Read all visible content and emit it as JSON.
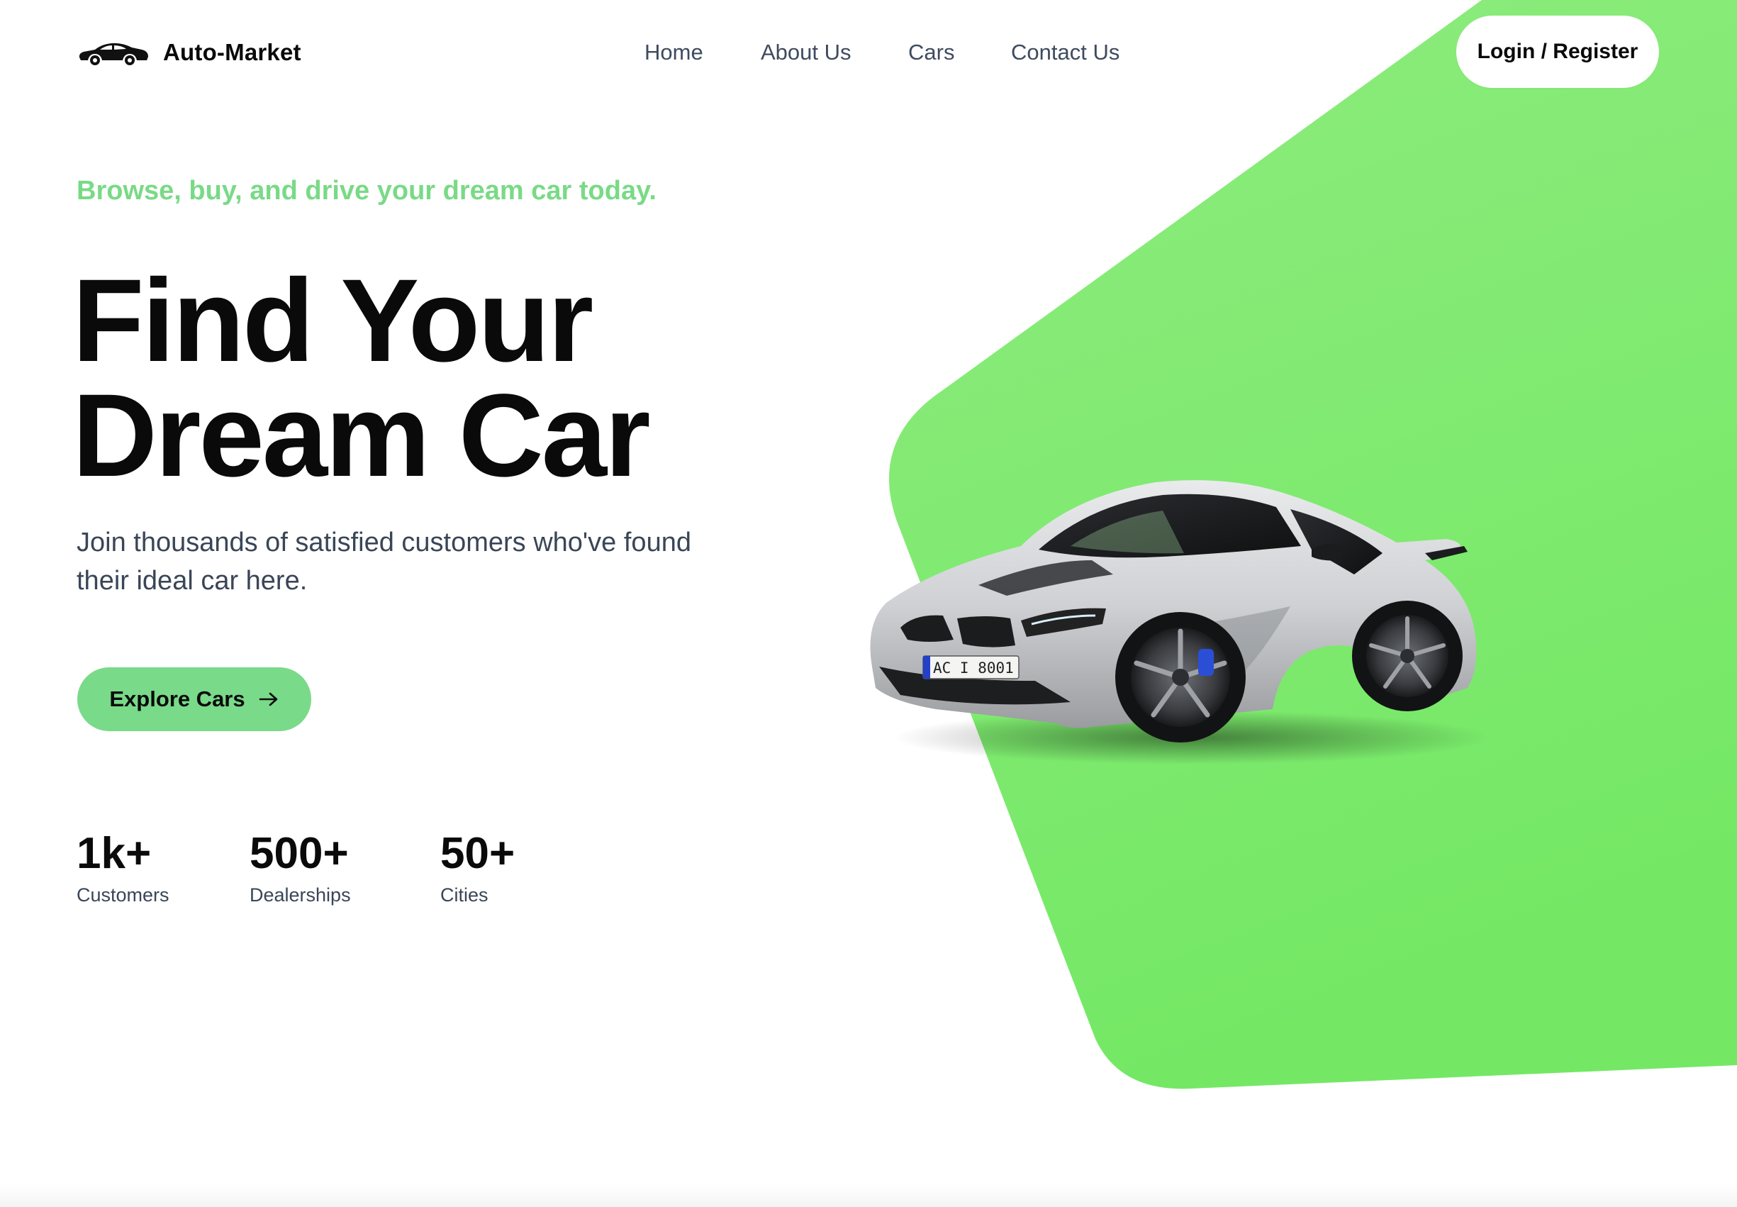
{
  "brand": {
    "name": "Auto-Market",
    "logo_icon": "car-icon"
  },
  "nav": {
    "items": [
      {
        "label": "Home"
      },
      {
        "label": "About Us"
      },
      {
        "label": "Cars"
      },
      {
        "label": "Contact Us"
      }
    ],
    "login_label": "Login / Register"
  },
  "hero": {
    "tagline": "Browse, buy, and drive your dream car today.",
    "headline_line1": "Find Your",
    "headline_line2": "Dream Car",
    "subtitle": "Join thousands of satisfied customers who've found their ideal car here.",
    "cta_label": "Explore Cars",
    "cta_icon": "arrow-right-icon",
    "car_plate": "AC I 8001"
  },
  "stats": [
    {
      "value": "1k+",
      "label": "Customers"
    },
    {
      "value": "500+",
      "label": "Dealerships"
    },
    {
      "value": "50+",
      "label": "Cities"
    }
  ],
  "colors": {
    "accent_green": "#79da86",
    "shape_green": "#7de96f",
    "text_dark": "#0a0a0a",
    "text_muted": "#3a4657"
  }
}
